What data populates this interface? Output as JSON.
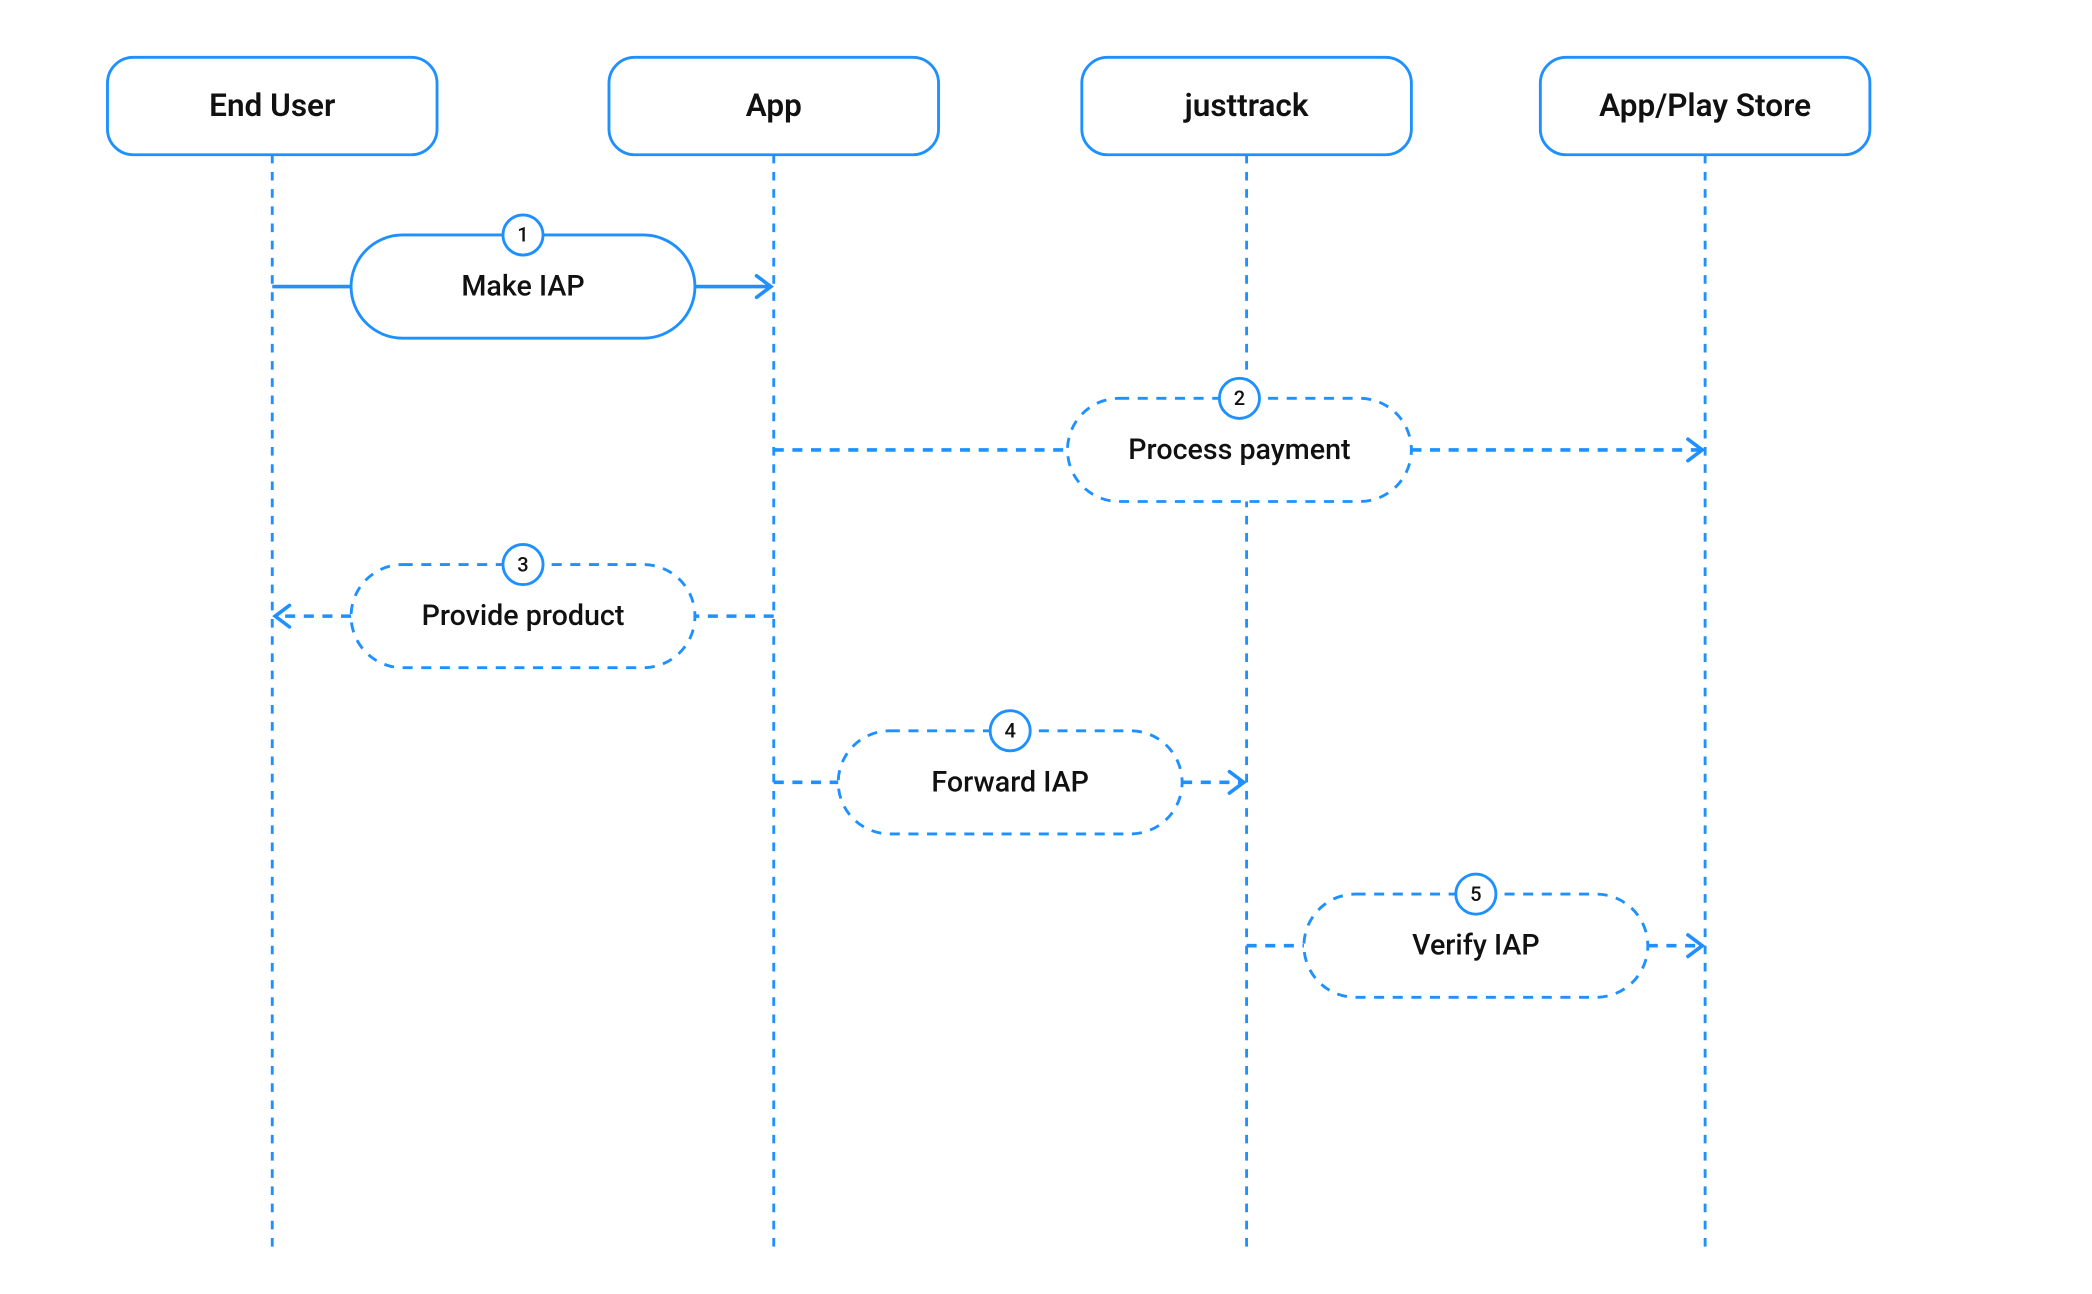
{
  "diagram": {
    "type": "sequence",
    "participants": [
      {
        "id": "end_user",
        "label": "End User"
      },
      {
        "id": "app",
        "label": "App"
      },
      {
        "id": "justtrack",
        "label": "justtrack"
      },
      {
        "id": "store",
        "label": "App/Play Store"
      }
    ],
    "messages": [
      {
        "n": "1",
        "label": "Make IAP",
        "from": "end_user",
        "to": "app",
        "style": "solid"
      },
      {
        "n": "2",
        "label": "Process payment",
        "from": "app",
        "to": "store",
        "style": "dashed"
      },
      {
        "n": "3",
        "label": "Provide product",
        "from": "app",
        "to": "end_user",
        "style": "dashed"
      },
      {
        "n": "4",
        "label": "Forward IAP",
        "from": "app",
        "to": "justtrack",
        "style": "dashed"
      },
      {
        "n": "5",
        "label": "Verify IAP",
        "from": "justtrack",
        "to": "store",
        "style": "dashed"
      }
    ],
    "colors": {
      "stroke": "#1e90ff",
      "text": "#111111",
      "bg": "#ffffff"
    }
  }
}
